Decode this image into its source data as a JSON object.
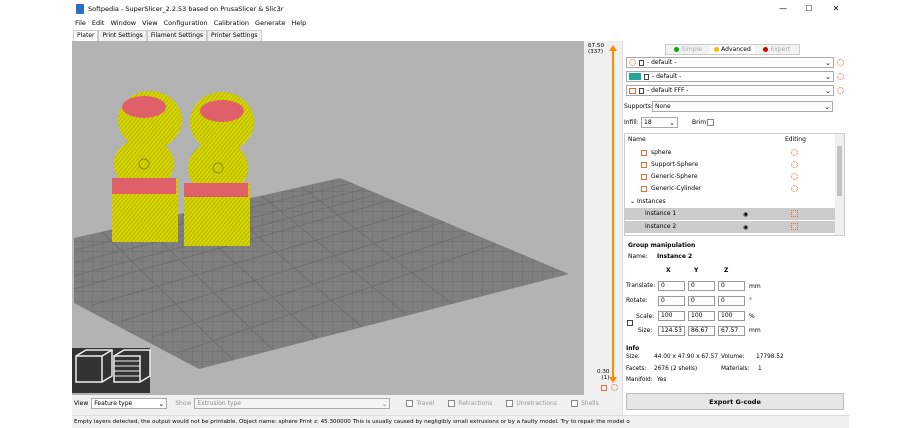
{
  "window": {
    "title": "Softpedia - SuperSlicer_2.2.53 based on PrusaSlicer & Slic3r",
    "min": "—",
    "max": "☐",
    "close": "✕"
  },
  "menu": [
    "File",
    "Edit",
    "Window",
    "View",
    "Configuration",
    "Calibration",
    "Generate",
    "Help"
  ],
  "tabs": [
    "Plater",
    "Print Settings",
    "Filament Settings",
    "Printer Settings"
  ],
  "slider": {
    "top_value": "67.50",
    "top_layer": "(337)",
    "bottom_value": "0.30",
    "bottom_layer": "(1)"
  },
  "modes": {
    "simple": "Simple",
    "advanced": "Advanced",
    "expert": "Expert"
  },
  "presets": {
    "print": "- default -",
    "filament": "- default -",
    "printer": "- default FFF -"
  },
  "supports": {
    "label": "Supports:",
    "value": "None"
  },
  "infill": {
    "label": "Infill:",
    "value": "18",
    "brim_label": "Brim:"
  },
  "objects": {
    "col_name": "Name",
    "col_editing": "Editing",
    "items": [
      "sphere",
      "Support-Sphere",
      "Generic-Sphere",
      "Generic-Cylinder"
    ],
    "instances_label": "Instances",
    "instances": [
      "Instance 1",
      "Instance 2"
    ]
  },
  "manip": {
    "title": "Group manipulation",
    "name_label": "Name:",
    "name_value": "Instance 2",
    "axes": [
      "X",
      "Y",
      "Z"
    ],
    "rows": [
      {
        "label": "Translate:",
        "values": [
          "0",
          "0",
          "0"
        ],
        "unit": "mm"
      },
      {
        "label": "Rotate:",
        "values": [
          "0",
          "0",
          "0"
        ],
        "unit": "°"
      },
      {
        "label": "Scale:",
        "values": [
          "100",
          "100",
          "100"
        ],
        "unit": "%"
      },
      {
        "label": "Size:",
        "values": [
          "124.53",
          "86.67",
          "67.57"
        ],
        "unit": "mm"
      }
    ]
  },
  "info": {
    "title": "Info",
    "size_label": "Size:",
    "size": "44.00 x 47.90 x 67.57",
    "volume_label": "Volume:",
    "volume": "17798.52",
    "facets_label": "Facets:",
    "facets": "2676 (2 shells)",
    "materials_label": "Materials:",
    "materials": "1",
    "manifold_label": "Manifold:",
    "manifold": "Yes"
  },
  "export_button": "Export G-code",
  "bottom": {
    "view_label": "View",
    "view_value": "Feature type",
    "show_label": "Show",
    "show_value": "Extrusion type",
    "checks": [
      "Travel",
      "Retractions",
      "Unretractions",
      "Shells"
    ]
  },
  "status": "Empty layers detected, the output would not be printable.  Object name: sphere Print z: 45.300000  This is usually caused by negligibly small extrusions or by a faulty model. Try to repair the model o",
  "colors": {
    "model": "#d9d900",
    "top": "#e0606a",
    "bed": "#7f7f7f",
    "accent": "#ff8a00"
  }
}
